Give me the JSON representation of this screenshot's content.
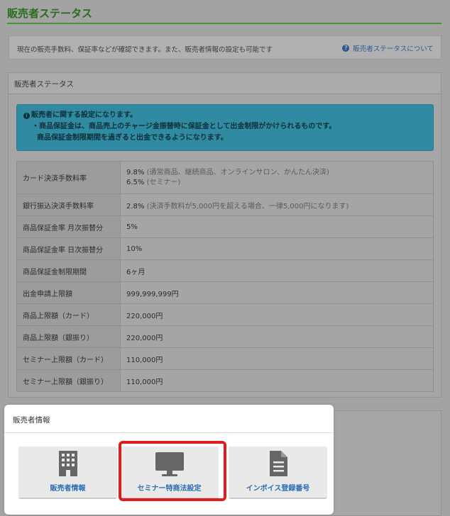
{
  "page": {
    "title": "販売者ステータス"
  },
  "info_bar": {
    "text": "現在の販売手数料、保証率などが確認できます。また、販売者情報の設定も可能です",
    "help_link": "販売者ステータスについて",
    "help_icon": "question-circle-icon"
  },
  "status_panel": {
    "title": "販売者ステータス",
    "alert": {
      "icon": "info-circle-icon",
      "line1": "販売者に関する設定になります。",
      "line2": "・商品保証金は、商品売上のチャージ金振替時に保証金として出金制限がかけられるものです。",
      "line3": "商品保証金制限期間を過ぎると出金できるようになります。"
    },
    "rows": [
      {
        "label": "カード決済手数料率",
        "value1": "9.8%",
        "note1": "(通常商品、継続商品、オンラインサロン、かんたん決済)",
        "value2": "6.5%",
        "note2": "(セミナー)"
      },
      {
        "label": "銀行振込決済手数料率",
        "value": "2.8%",
        "note": "(決済手数料が5,000円を超える場合、一律5,000円になります)"
      },
      {
        "label": "商品保証金率 月次振替分",
        "value": "5%"
      },
      {
        "label": "商品保証金率 日次振替分",
        "value": "10%"
      },
      {
        "label": "商品保証金制限期間",
        "value": "6ヶ月"
      },
      {
        "label": "出金申請上限額",
        "value": "999,999,999円"
      },
      {
        "label": "商品上限額（カード）",
        "value": "220,000円"
      },
      {
        "label": "商品上限額（銀振り）",
        "value": "220,000円"
      },
      {
        "label": "セミナー上限額（カード）",
        "value": "110,000円"
      },
      {
        "label": "セミナー上限額（銀振り）",
        "value": "110,000円"
      }
    ]
  },
  "seller_info": {
    "title": "販売者情報",
    "tiles": [
      {
        "label": "販売者情報",
        "icon": "building-icon"
      },
      {
        "label": "セミナー特商法設定",
        "icon": "monitor-icon"
      },
      {
        "label": "インボイス登録番号",
        "icon": "document-icon"
      }
    ],
    "highlight_color": "#e01c1c"
  }
}
